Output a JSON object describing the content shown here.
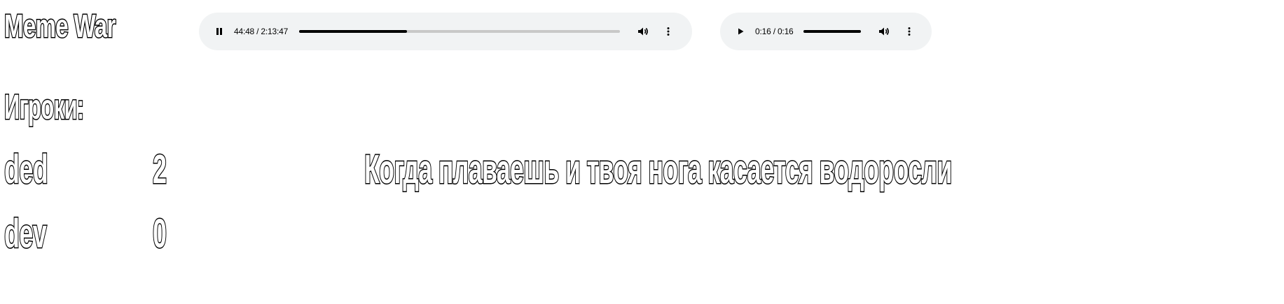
{
  "page": {
    "title": "Meme War",
    "players_heading": "Игроки:",
    "meme_caption": "Когда плаваешь и твоя нога касается водоросли"
  },
  "players": [
    {
      "name": "ded",
      "score": "2"
    },
    {
      "name": "dev",
      "score": "0"
    }
  ],
  "audio_players": [
    {
      "state": "playing",
      "play_icon": "pause-icon",
      "time": "44:48 / 2:13:47",
      "progress_fraction": 0.335,
      "volume_icon": "volume-icon",
      "menu_icon": "more-options-icon"
    },
    {
      "state": "paused",
      "play_icon": "play-icon",
      "time": "0:16 / 0:16",
      "progress_fraction": 1.0,
      "volume_icon": "volume-icon",
      "menu_icon": "more-options-icon"
    }
  ],
  "colors": {
    "player_background": "#f1f3f4",
    "progress_fill": "#000000",
    "progress_track": "#c8c8c8",
    "text_outline": "#000000",
    "text_fill": "#ffffff"
  }
}
